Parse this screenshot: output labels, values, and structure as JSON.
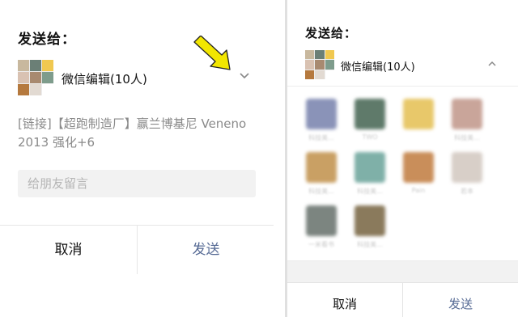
{
  "left": {
    "title": "发送给：",
    "group_name": "微信编辑(10人)",
    "link_text": "[链接]【超跑制造厂】赢兰博基尼 Veneno 2013 强化+6",
    "message_placeholder": "给朋友留言",
    "cancel_label": "取消",
    "send_label": "发送"
  },
  "right": {
    "title": "发送给：",
    "group_name": "微信编辑(10人)",
    "cancel_label": "取消",
    "send_label": "发送",
    "members": [
      {
        "name": "科技美...",
        "color": "#8a93b8"
      },
      {
        "name": "TWO",
        "color": "#5f7a6a"
      },
      {
        "name": "",
        "color": "#e8c86a"
      },
      {
        "name": "科技美...",
        "color": "#c9a59a"
      },
      {
        "name": "科技美...",
        "color": "#c9a064"
      },
      {
        "name": "科技美...",
        "color": "#7fb0a8"
      },
      {
        "name": "Pain",
        "color": "#c98e5a"
      },
      {
        "name": "若本",
        "color": "#d8cfc8"
      },
      {
        "name": "一米看书",
        "color": "#7c8580"
      },
      {
        "name": "科技美...",
        "color": "#8a7a5c"
      }
    ]
  },
  "colors": {
    "accent": "#576b95",
    "annotation_arrow": "#f2e600"
  },
  "icons": {
    "collapse": "chevron-down-icon",
    "expand": "chevron-up-icon",
    "annotation": "arrow-annotation-icon"
  }
}
